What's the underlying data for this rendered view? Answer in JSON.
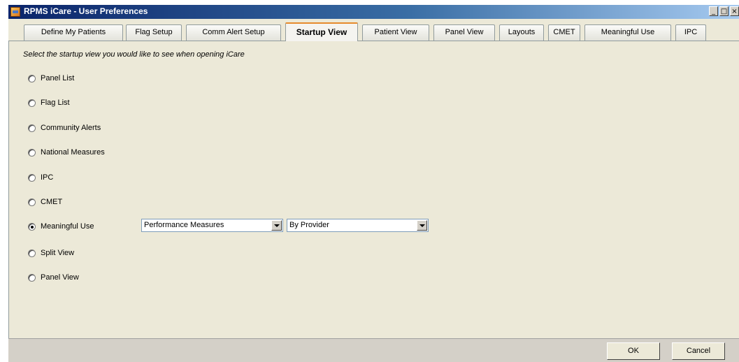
{
  "window": {
    "title": "RPMS iCare - User Preferences",
    "controls": {
      "minimize": "_",
      "maximize": "□",
      "close": "×"
    }
  },
  "tabs": [
    {
      "label": "Define My Patients"
    },
    {
      "label": "Flag Setup"
    },
    {
      "label": "Comm Alert Setup"
    },
    {
      "label": "Startup View",
      "active": true
    },
    {
      "label": "Patient View"
    },
    {
      "label": "Panel View"
    },
    {
      "label": "Layouts"
    },
    {
      "label": "CMET"
    },
    {
      "label": "Meaningful Use"
    },
    {
      "label": "IPC"
    }
  ],
  "startup": {
    "instruction": "Select the startup view you would like to see when opening iCare",
    "options": [
      {
        "label": "Panel List",
        "checked": false
      },
      {
        "label": "Flag List",
        "checked": false
      },
      {
        "label": "Community Alerts",
        "checked": false
      },
      {
        "label": "National Measures",
        "checked": false
      },
      {
        "label": "IPC",
        "checked": false
      },
      {
        "label": "CMET",
        "checked": false
      },
      {
        "label": "Meaningful Use",
        "checked": true
      },
      {
        "label": "Split View",
        "checked": false
      },
      {
        "label": "Panel View",
        "checked": false
      }
    ],
    "meaningful_use_measure": "Performance Measures",
    "meaningful_use_grouping": "By Provider"
  },
  "buttons": {
    "ok": "OK",
    "cancel": "Cancel"
  },
  "colors": {
    "title_bar": "#0a246a",
    "active_tab_accent": "#e68b2c",
    "panel_bg": "#ece9d8"
  }
}
